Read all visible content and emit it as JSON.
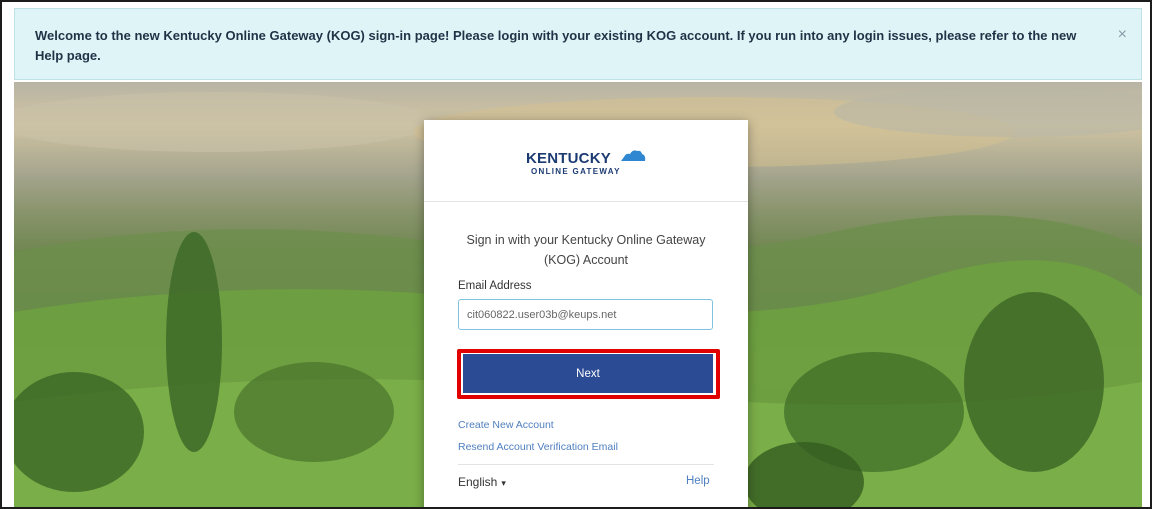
{
  "banner": {
    "message": "Welcome to the new Kentucky Online Gateway (KOG) sign-in page! Please login with your existing KOG account. If you run into any login issues, please refer to the new Help page.",
    "close_icon": "×"
  },
  "logo": {
    "main": "KENTUCKY",
    "sub": "ONLINE GATEWAY",
    "icon": "kentucky-state-shape-icon"
  },
  "signin": {
    "title": "Sign in with your Kentucky Online Gateway (KOG) Account",
    "email_label": "Email Address",
    "email_value": "cit060822.user03b@keups.net",
    "next_label": "Next",
    "create_account": "Create New Account",
    "resend_verification": "Resend Account Verification Email"
  },
  "footer": {
    "language": "English",
    "language_chevron": "▾",
    "help": "Help"
  },
  "colors": {
    "banner_bg": "#dff4f6",
    "primary_button": "#2b4b95",
    "highlight": "#e00000",
    "link": "#4f7fbf",
    "logo": "#1c3b73"
  }
}
